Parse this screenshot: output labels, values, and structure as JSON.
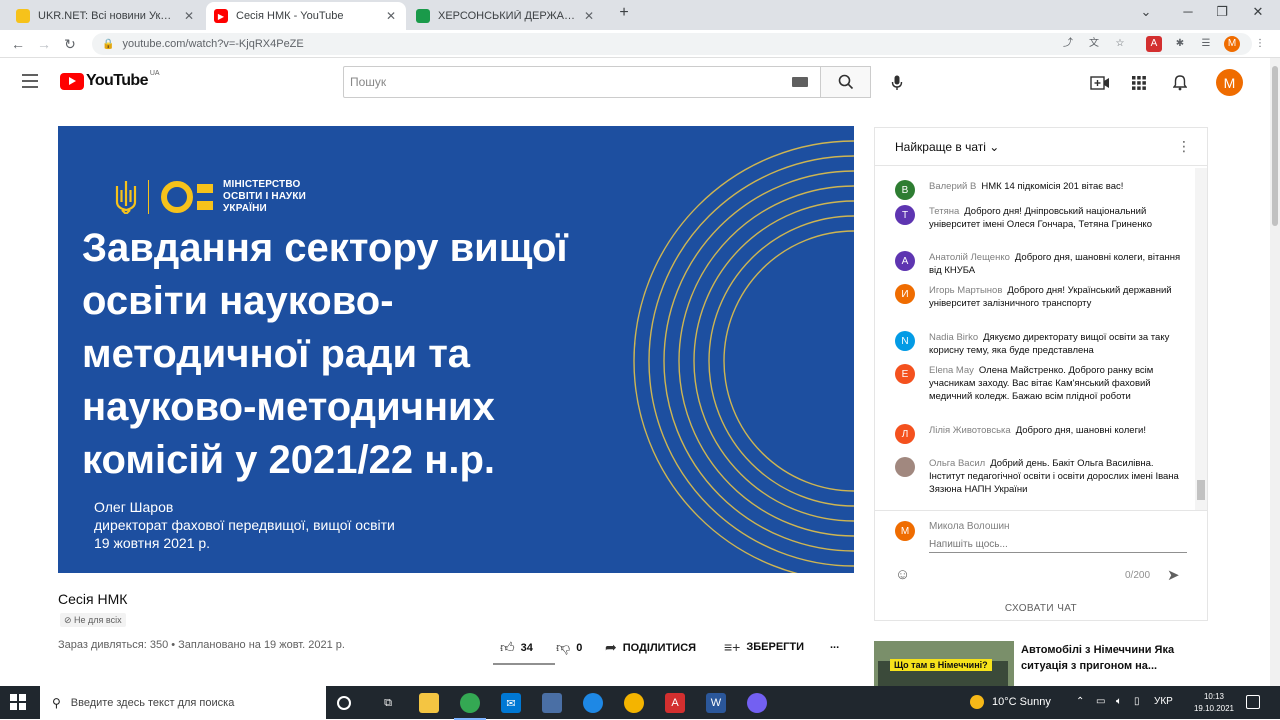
{
  "browser": {
    "tabs": [
      {
        "title": "UKR.NET: Всі новини України, о",
        "favicon_color": "#f6c21b",
        "active": false
      },
      {
        "title": "Сесія НМК - YouTube",
        "favicon_color": "#ff0000",
        "active": true
      },
      {
        "title": "ХЕРСОНСЬКИЙ ДЕРЖАВНИЙ А",
        "favicon_color": "#1a9a4a",
        "active": false
      }
    ],
    "new_tab": "+",
    "url": "youtube.com/watch?v=-KjqRX4PeZE",
    "profile_initial": "M"
  },
  "youtube": {
    "logo_text": "YouTube",
    "logo_region": "UA",
    "search_placeholder": "Пошук",
    "avatar_initial": "M"
  },
  "slide": {
    "ministry": [
      "МІНІСТЕРСТВО",
      "ОСВІТИ І НАУКИ",
      "УКРАЇНИ"
    ],
    "title_lines": [
      "Завдання сектору вищої",
      "освіти науково-",
      "методичної ради та",
      "науково-методичних",
      "комісій у 2021/22 н.р."
    ],
    "author_lines": [
      "Олег Шаров",
      "директорат фахової передвищої, вищої освіти",
      "19 жовтня 2021 р."
    ]
  },
  "video": {
    "title": "Сесія НМК",
    "badge": "Не для всіх",
    "meta": "Зараз дивляться: 350 • Заплановано на 19 жовт. 2021 р.",
    "likes": "34",
    "dislikes": "0",
    "share_label": "ПОДІЛИТИСЯ",
    "save_label": "ЗБЕРЕГТИ",
    "more": "..."
  },
  "chat": {
    "header": "Найкраще в чаті",
    "messages": [
      {
        "initial": "В",
        "color": "#2e7d32",
        "author": "Валерий В",
        "text": "НМК 14 підкомісія 201 вітає вас!"
      },
      {
        "initial": "Т",
        "color": "#5e35b1",
        "author": "Тетяна",
        "text": "Доброго дня! Дніпровський національний університет імені Олеся Гончара, Тетяна Гриненко"
      },
      {
        "initial": "А",
        "color": "#5e35b1",
        "author": "Анатолій Лещенко",
        "text": "Доброго дня, шановні колеги, вітання від КНУБА"
      },
      {
        "initial": "И",
        "color": "#ef6c00",
        "author": "Игорь Мартынов",
        "text": "Доброго дня! Український державний університет залізничного транспорту"
      },
      {
        "initial": "N",
        "color": "#039be5",
        "author": "Nadia Birko",
        "text": "Дякуємо директорату вищої освіти за таку корисну тему, яка буде представлена"
      },
      {
        "initial": "E",
        "color": "#f4511e",
        "author": "Elena May",
        "text": "Олена Майстренко. Доброго ранку всім учасникам заходу. Вас вітає Кам'янський фаховий медичний коледж. Бажаю всім плідної роботи"
      },
      {
        "initial": "Л",
        "color": "#f4511e",
        "author": "Лілія Животовська",
        "text": "Доброго дня, шановні колеги!"
      },
      {
        "initial": "",
        "color": "#a1887f",
        "author": "Ольга Васил",
        "text": "Добрий день. Бакіт Ольга Василівна. Інститут педагогічної освіти і освіти дорослих імені Івана Зязюна НАПН України"
      }
    ],
    "current_user": "Микола Волошин",
    "current_initial": "М",
    "input_placeholder": "Напишіть щось...",
    "counter": "0/200",
    "hide_label": "СХОВАТИ ЧАТ"
  },
  "related": {
    "thumb_caption": "Що там в Німеччині?",
    "title": "Автомобілі з Німеччини Яка ситуація з пригоном на..."
  },
  "taskbar": {
    "search_placeholder": "Введите здесь текст для поиска",
    "weather": "10°C  Sunny",
    "lang": "УКР",
    "time": "10:13",
    "date": "19.10.2021"
  }
}
